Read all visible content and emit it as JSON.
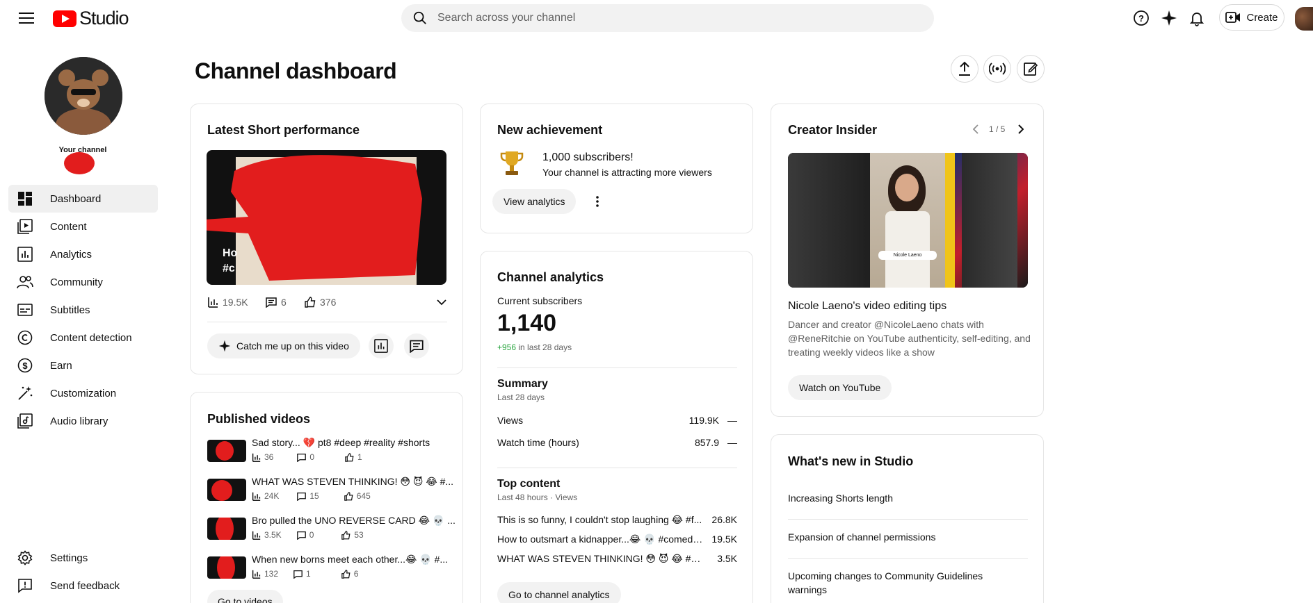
{
  "header": {
    "app_name": "Studio",
    "search_placeholder": "Search across your channel",
    "create_label": "Create"
  },
  "sidebar": {
    "channel_label": "Your channel",
    "items": [
      {
        "label": "Dashboard",
        "icon": "dashboard-icon",
        "active": true
      },
      {
        "label": "Content",
        "icon": "content-icon"
      },
      {
        "label": "Analytics",
        "icon": "analytics-icon"
      },
      {
        "label": "Community",
        "icon": "community-icon"
      },
      {
        "label": "Subtitles",
        "icon": "subtitles-icon"
      },
      {
        "label": "Content detection",
        "icon": "copyright-icon"
      },
      {
        "label": "Earn",
        "icon": "dollar-icon"
      },
      {
        "label": "Customization",
        "icon": "magic-wand-icon"
      },
      {
        "label": "Audio library",
        "icon": "audio-library-icon"
      }
    ],
    "bottom_items": [
      {
        "label": "Settings",
        "icon": "gear-icon"
      },
      {
        "label": "Send feedback",
        "icon": "feedback-icon"
      }
    ]
  },
  "main": {
    "title": "Channel dashboard"
  },
  "latest_short": {
    "title": "Latest Short performance",
    "overlay_text_1": "Ho",
    "overlay_text_2": "#c",
    "views": "19.5K",
    "comments": "6",
    "likes": "376",
    "catch_up_label": "Catch me up on this video"
  },
  "published_videos": {
    "title": "Published videos",
    "items": [
      {
        "title": "Sad story... 💔 pt8 #deep #reality #shorts",
        "views": "36",
        "comments": "0",
        "likes": "1"
      },
      {
        "title": "WHAT WAS STEVEN THINKING! 😳 😈 😂 #...",
        "views": "24K",
        "comments": "15",
        "likes": "645"
      },
      {
        "title": "Bro pulled the UNO REVERSE CARD 😂 💀 ...",
        "views": "3.5K",
        "comments": "0",
        "likes": "53"
      },
      {
        "title": "When new borns meet each other...😂 💀 #...",
        "views": "132",
        "comments": "1",
        "likes": "6"
      }
    ],
    "go_label": "Go to videos"
  },
  "achievement": {
    "title": "New achievement",
    "headline": "1,000 subscribers!",
    "subtext": "Your channel is attracting more viewers",
    "button_label": "View analytics"
  },
  "channel_analytics": {
    "title": "Channel analytics",
    "subs_label": "Current subscribers",
    "subs_value": "1,140",
    "subs_change": "+956",
    "subs_change_suffix": " in last 28 days",
    "summary_title": "Summary",
    "summary_period": "Last 28 days",
    "summary_rows": [
      {
        "label": "Views",
        "value": "119.9K",
        "trend": "—"
      },
      {
        "label": "Watch time (hours)",
        "value": "857.9",
        "trend": "—"
      }
    ],
    "top_title": "Top content",
    "top_period": "Last 48 hours · Views",
    "top_rows": [
      {
        "title": "This is so funny, I couldn't stop laughing 😂 #f...",
        "value": "26.8K"
      },
      {
        "title": "How to outsmart a kidnapper...😂 💀 #comedy...",
        "value": "19.5K"
      },
      {
        "title": "WHAT WAS STEVEN THINKING! 😳 😈 😂 #sh...",
        "value": "3.5K"
      }
    ],
    "go_label": "Go to channel analytics"
  },
  "creator_insider": {
    "title": "Creator Insider",
    "pager": "1 / 5",
    "name_tag": "Nicole Laeno",
    "video_title": "Nicole Laeno's video editing tips",
    "description": "Dancer and creator @NicoleLaeno chats with @ReneRitchie on YouTube authenticity, self-editing, and treating weekly videos like a show",
    "button_label": "Watch on YouTube"
  },
  "whats_new": {
    "title": "What's new in Studio",
    "items": [
      "Increasing Shorts length",
      "Expansion of channel permissions",
      "Upcoming changes to Community Guidelines warnings"
    ]
  },
  "colors": {
    "brand_red": "#ff0000",
    "positive_green": "#2ba640",
    "pill_bg": "#f2f2f2"
  }
}
